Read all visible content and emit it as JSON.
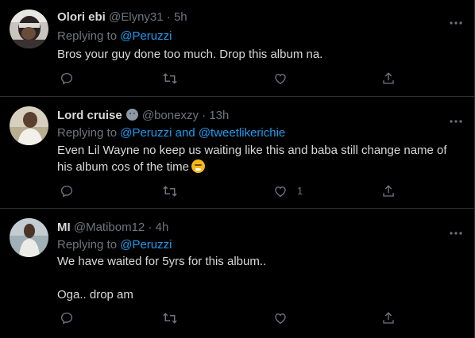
{
  "tweets": [
    {
      "name": "Olori ebi",
      "handle": "@Elyny31",
      "dot": "·",
      "time": "5h",
      "replying_prefix": "Replying to ",
      "replying_to": "@Peruzzi",
      "body": "Bros your guy done too much. Drop this album na.",
      "like_count": "",
      "avatar": "avatar-olori-ebi"
    },
    {
      "name": "Lord cruise",
      "name_emoji": "face-emoji",
      "handle": "@bonexzy",
      "dot": "·",
      "time": "13h",
      "replying_prefix": "Replying to ",
      "replying_to": "@Peruzzi and @tweetlikerichie",
      "body_line1": "Even Lil Wayne no keep us waiting like this and baba still change name of",
      "body_line2": "his album cos of the time",
      "body_emoji": "yawning-face-emoji",
      "like_count": "1",
      "avatar": "avatar-lord-cruise"
    },
    {
      "name": "MI",
      "handle": "@Matibom12",
      "dot": "·",
      "time": "4h",
      "replying_prefix": "Replying to ",
      "replying_to": "@Peruzzi",
      "body_line1": "We have waited for 5yrs for this album..",
      "body_line2": "Oga..  drop am",
      "like_count": "",
      "avatar": "avatar-mi"
    }
  ],
  "icons": {
    "reply": "reply-icon",
    "retweet": "retweet-icon",
    "like": "like-icon",
    "share": "share-icon",
    "more": "more-icon"
  },
  "colors": {
    "background": "#000000",
    "text": "#d9d9d9",
    "muted": "#6e767d",
    "link": "#1d9bf0",
    "divider": "#2f3336"
  }
}
